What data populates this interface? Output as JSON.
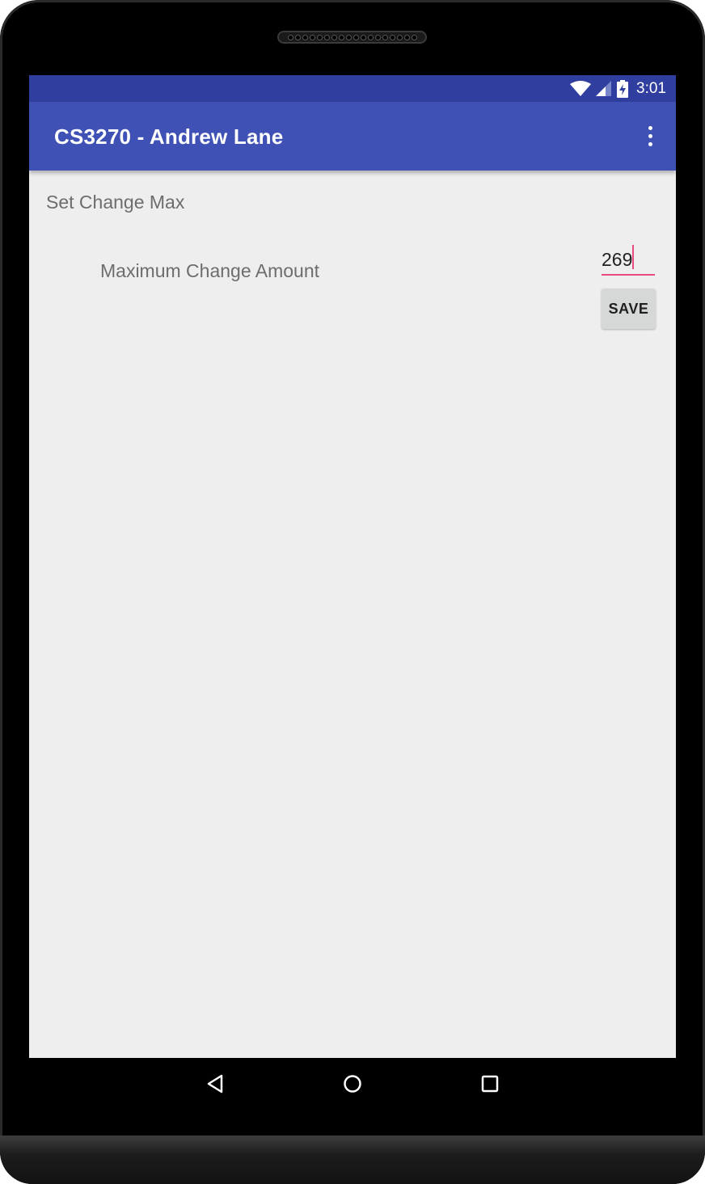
{
  "status_bar": {
    "time": "3:01",
    "icons": [
      "wifi-icon",
      "cell-signal-icon",
      "battery-charging-icon"
    ],
    "color": "#303f9f"
  },
  "app_bar": {
    "title": "CS3270 - Andrew Lane",
    "color": "#3f51b5",
    "menu_icon": "overflow-menu-icon"
  },
  "main": {
    "section_title": "Set Change Max",
    "field_label": "Maximum Change Amount",
    "amount_value": "269",
    "save_label": "SAVE",
    "accent_color": "#e94a7f"
  },
  "nav_bar": {
    "icons": [
      "back-icon",
      "home-icon",
      "recents-icon"
    ]
  }
}
